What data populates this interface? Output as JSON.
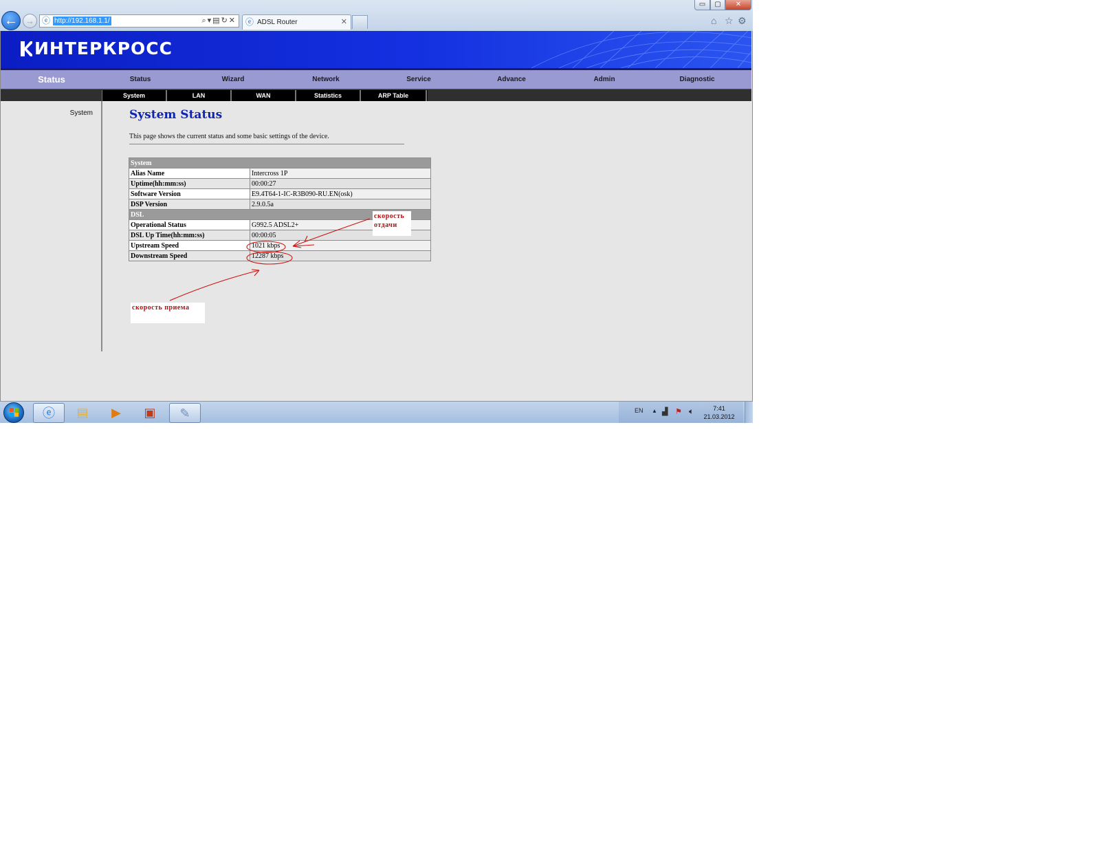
{
  "browser": {
    "url": "http://192.168.1.1/",
    "tab_title": "ADSL Router",
    "window_controls": {
      "minimize": "▭",
      "maximize": "▢",
      "close": "✕"
    }
  },
  "banner": {
    "logo_text": "ИНТЕРКРОСС"
  },
  "main_nav": {
    "current": "Status",
    "items": [
      "Status",
      "Wizard",
      "Network",
      "Service",
      "Advance",
      "Admin",
      "Diagnostic"
    ]
  },
  "sub_nav": {
    "items": [
      "System",
      "LAN",
      "WAN",
      "Statistics",
      "ARP Table"
    ]
  },
  "sidebar": {
    "items": [
      "System"
    ]
  },
  "content": {
    "title": "System Status",
    "description": "This page shows the current status and some basic settings of the device."
  },
  "status_table": {
    "system_header": "System",
    "dsl_header": "DSL",
    "system_rows": [
      {
        "label": "Alias Name",
        "value": "Intercross 1P"
      },
      {
        "label": "Uptime(hh:mm:ss)",
        "value": "00:00:27"
      },
      {
        "label": "Software Version",
        "value": "E9.4T64-1-IC-R3B090-RU.EN(osk)"
      },
      {
        "label": "DSP Version",
        "value": "2.9.0.5a"
      }
    ],
    "dsl_rows": [
      {
        "label": "Operational Status",
        "value": "G992.5 ADSL2+"
      },
      {
        "label": "DSL Up Time(hh:mm:ss)",
        "value": "00:00:05"
      },
      {
        "label": "Upstream Speed",
        "value": "1021 kbps"
      },
      {
        "label": "Downstream Speed",
        "value": "12287 kbps"
      }
    ]
  },
  "annotations": {
    "upload_note": "скорость отдачи",
    "download_note": "скорость приема",
    "color": "#cc1111"
  },
  "taskbar": {
    "lang": "EN",
    "time": "7:41",
    "date": "21.03.2012"
  },
  "colors": {
    "banner": "#1430e0",
    "nav_bar": "#9a9ad2",
    "title_blue": "#1024b4"
  }
}
